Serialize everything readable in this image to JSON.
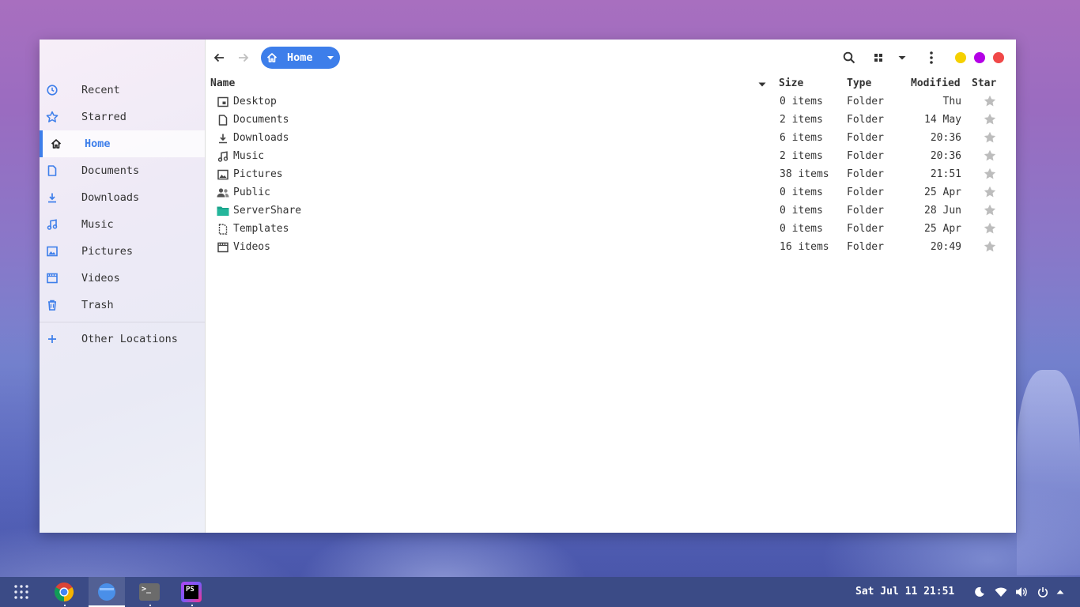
{
  "sidebar": {
    "items": [
      {
        "label": "Recent",
        "icon": "clock-icon"
      },
      {
        "label": "Starred",
        "icon": "star-icon"
      },
      {
        "label": "Home",
        "icon": "home-icon"
      },
      {
        "label": "Documents",
        "icon": "document-icon"
      },
      {
        "label": "Downloads",
        "icon": "download-icon"
      },
      {
        "label": "Music",
        "icon": "music-icon"
      },
      {
        "label": "Pictures",
        "icon": "picture-icon"
      },
      {
        "label": "Videos",
        "icon": "video-icon"
      },
      {
        "label": "Trash",
        "icon": "trash-icon"
      }
    ],
    "other_locations": "Other Locations",
    "active": "Home"
  },
  "toolbar": {
    "path_label": "Home",
    "window_dot_colors": [
      "#f5d000",
      "#b400e6",
      "#f04848"
    ]
  },
  "list": {
    "headers": {
      "name": "Name",
      "size": "Size",
      "type": "Type",
      "modified": "Modified",
      "star": "Star"
    },
    "rows": [
      {
        "name": "Desktop",
        "size": "0 items",
        "type": "Folder",
        "modified": "Thu",
        "icon": "desktop-folder-icon"
      },
      {
        "name": "Documents",
        "size": "2 items",
        "type": "Folder",
        "modified": "14 May",
        "icon": "document-folder-icon"
      },
      {
        "name": "Downloads",
        "size": "6 items",
        "type": "Folder",
        "modified": "20:36",
        "icon": "download-folder-icon"
      },
      {
        "name": "Music",
        "size": "2 items",
        "type": "Folder",
        "modified": "20:36",
        "icon": "music-folder-icon"
      },
      {
        "name": "Pictures",
        "size": "38 items",
        "type": "Folder",
        "modified": "21:51",
        "icon": "picture-folder-icon"
      },
      {
        "name": "Public",
        "size": "0 items",
        "type": "Folder",
        "modified": "25 Apr",
        "icon": "public-folder-icon"
      },
      {
        "name": "ServerShare",
        "size": "0 items",
        "type": "Folder",
        "modified": "28 Jun",
        "icon": "green-folder-icon"
      },
      {
        "name": "Templates",
        "size": "0 items",
        "type": "Folder",
        "modified": "25 Apr",
        "icon": "template-folder-icon"
      },
      {
        "name": "Videos",
        "size": "16 items",
        "type": "Folder",
        "modified": "20:49",
        "icon": "video-folder-icon"
      }
    ]
  },
  "taskbar": {
    "apps": [
      "app-grid-icon",
      "chrome-icon",
      "files-icon",
      "terminal-icon",
      "phpstorm-icon"
    ],
    "ps_label": "PS",
    "terminal_label": ">_",
    "clock": "Sat Jul 11 21:51"
  },
  "colors": {
    "accent": "#3d7eea",
    "taskbar": "#3b4b86",
    "star": "#bdbdbd"
  }
}
